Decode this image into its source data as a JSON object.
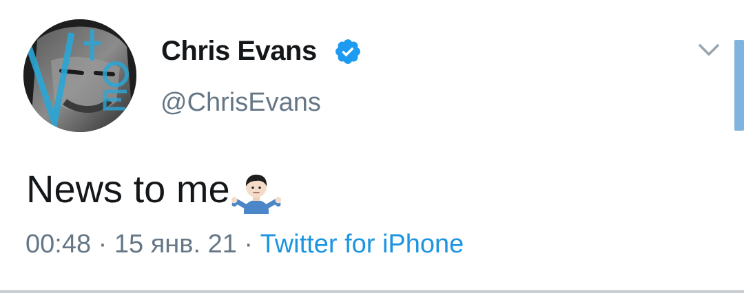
{
  "tweet": {
    "display_name": "Chris Evans",
    "handle": "@ChrisEvans",
    "verified": true,
    "text": "News to me",
    "emoji": "🤷🏻‍♂️",
    "time": "00:48",
    "separator": " · ",
    "date": "15 янв. 21",
    "source": "Twitter for iPhone"
  },
  "icons": {
    "verified": "verified-badge-icon",
    "menu": "chevron-down-icon",
    "emoji": "person-shrugging-icon"
  },
  "colors": {
    "text_primary": "#14171a",
    "text_secondary": "#657786",
    "link_blue": "#1b95e0",
    "verified_blue": "#1d9bf0"
  }
}
